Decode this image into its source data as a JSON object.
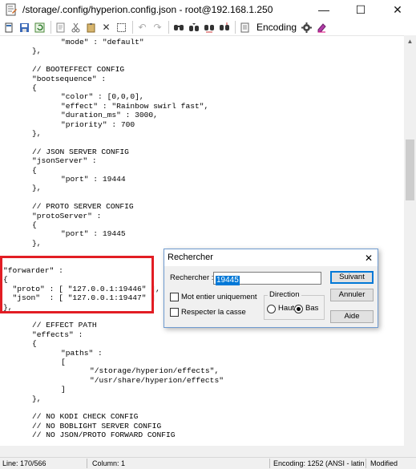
{
  "window": {
    "title": "/storage/.config/hyperion.config.json - root@192.168.1.250",
    "minimize": "—",
    "maximize": "☐",
    "close": "✕"
  },
  "toolbar": {
    "encoding_label": "Encoding",
    "icons": [
      "new-icon",
      "save-icon",
      "reload-icon",
      "cut-icon",
      "copy-icon",
      "paste-icon",
      "delete-icon",
      "select-all-icon",
      "undo-icon",
      "redo-icon",
      "find-icon",
      "find-next-icon",
      "replace-icon",
      "goto-icon",
      "settings-icon",
      "color-icon"
    ]
  },
  "editor": {
    "lines": [
      "\t\t\"mode\" : \"default\"",
      "\t},",
      "",
      "\t// BOOTEFFECT CONFIG",
      "\t\"bootsequence\" :",
      "\t{",
      "\t\t\"color\" : [0,0,0],",
      "\t\t\"effect\" : \"Rainbow swirl fast\",",
      "\t\t\"duration_ms\" : 3000,",
      "\t\t\"priority\" : 700",
      "\t},",
      "",
      "\t// JSON SERVER CONFIG",
      "\t\"jsonServer\" :",
      "\t{",
      "\t\t\"port\" : 19444",
      "\t},",
      "",
      "\t// PROTO SERVER CONFIG",
      "\t\"protoServer\" :",
      "\t{",
      "\t\t\"port\" : 19445",
      "\t},",
      "",
      "",
      "\"forwarder\" :",
      "{",
      "  \"proto\" : [ \"127.0.0.1:19446\" ],",
      "  \"json\"  : [ \"127.0.0.1:19447\" ]",
      "},",
      "",
      "\t// EFFECT PATH",
      "\t\"effects\" :",
      "\t{",
      "\t\t\"paths\" :",
      "\t\t[",
      "\t\t\t\"/storage/hyperion/effects\",",
      "\t\t\t\"/usr/share/hyperion/effects\"",
      "\t\t]",
      "\t},",
      "",
      "\t// NO KODI CHECK CONFIG",
      "\t// NO BOBLIGHT SERVER CONFIG",
      "\t// NO JSON/PROTO FORWARD CONFIG"
    ]
  },
  "statusbar": {
    "line": "Line: 170/566",
    "column": "Column: 1",
    "encoding": "Encoding: 1252  (ANSI - latin I)",
    "modified": "Modified"
  },
  "find_dialog": {
    "title": "Rechercher",
    "close": "✕",
    "search_label": "Rechercher :",
    "search_value": "19445",
    "whole_word": "Mot entier uniquement",
    "match_case": "Respecter la casse",
    "direction_label": "Direction",
    "up": "Haut",
    "down": "Bas",
    "direction_selected": "down",
    "next_button": "Suivant",
    "cancel_button": "Annuler",
    "help_button": "Aide"
  },
  "colors": {
    "highlight_border": "#e21d24",
    "selection": "#0078d7",
    "dialog_border": "#6f9bd0"
  }
}
